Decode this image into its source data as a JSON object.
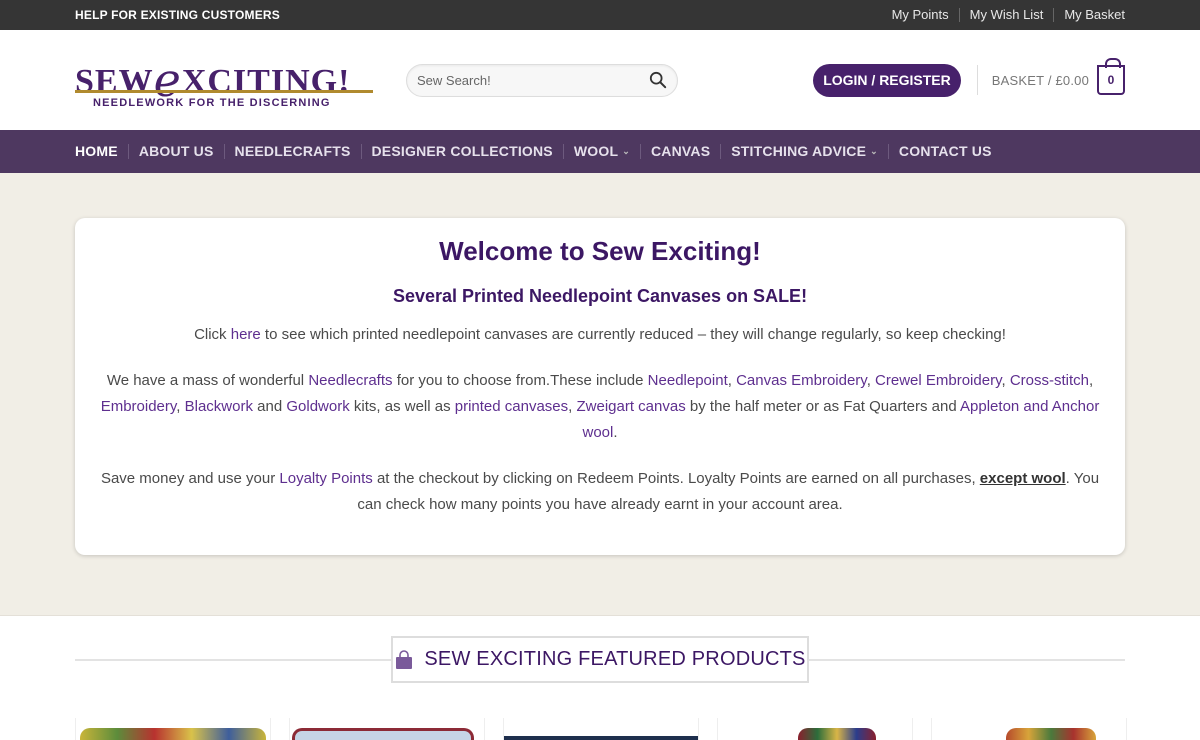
{
  "topbar": {
    "help": "HELP FOR EXISTING CUSTOMERS",
    "links": [
      "My Points",
      "My Wish List",
      "My Basket"
    ]
  },
  "logo": {
    "word_before": "SEW",
    "word_e": "e",
    "word_after": "XCITING!",
    "tagline": "NEEDLEWORK FOR THE DISCERNING"
  },
  "search": {
    "placeholder": "Sew Search!"
  },
  "account": {
    "login_label": "LOGIN / REGISTER",
    "basket_label": "BASKET / £0.00",
    "basket_count": "0"
  },
  "nav": [
    {
      "label": "HOME"
    },
    {
      "label": "ABOUT US"
    },
    {
      "label": "NEEDLECRAFTS"
    },
    {
      "label": "DESIGNER COLLECTIONS"
    },
    {
      "label": "WOOL",
      "chevron": "⌄"
    },
    {
      "label": "CANVAS"
    },
    {
      "label": "STITCHING ADVICE",
      "chevron": "⌄"
    },
    {
      "label": "CONTACT US"
    }
  ],
  "welcome": {
    "title": "Welcome to Sew Exciting!",
    "subtitle": "Several Printed Needlepoint Canvases on SALE!",
    "p1": {
      "before": "Click ",
      "link": "here",
      "after": " to see which printed needlepoint canvases are currently reduced – they will change regularly, so keep checking!"
    },
    "p2": {
      "t0": "We have a  mass of wonderful ",
      "l0": "Needlecrafts",
      "t1": " for you to choose from.These include ",
      "l1": "Needlepoint",
      "t2": ", ",
      "l2": "Canvas Embroidery",
      "t3": ", ",
      "l3": "Crewel Embroidery",
      "t4": ", ",
      "l4": "Cross-stitch",
      "t5": ", ",
      "l5": "Embroidery",
      "t6": ", ",
      "l6": "Blackwork",
      "t7": " and ",
      "l7": "Goldwork",
      "t8": " kits, as well as ",
      "l8": "printed canvases",
      "t9": ", ",
      "l9": "Zweigart canvas",
      "t10": " by the half meter or as Fat Quarters and ",
      "l10": "Appleton and Anchor wool",
      "t11": "."
    },
    "p3": {
      "t0": "Save money and use your ",
      "l0": "Loyalty Points",
      "t1": " at the checkout by clicking on Redeem Points. Loyalty Points are earned on all purchases, ",
      "l1": "except wool",
      "t2": ". You can check how many points you have already earnt in your account area."
    }
  },
  "featured": {
    "title": "SEW EXCITING FEATURED PRODUCTS",
    "icon": "shopping-bag-icon"
  },
  "colors": {
    "brand_purple": "#47216b",
    "nav_bg": "#4e3860",
    "topbar_bg": "#353535",
    "page_bg": "#f1eee6"
  }
}
